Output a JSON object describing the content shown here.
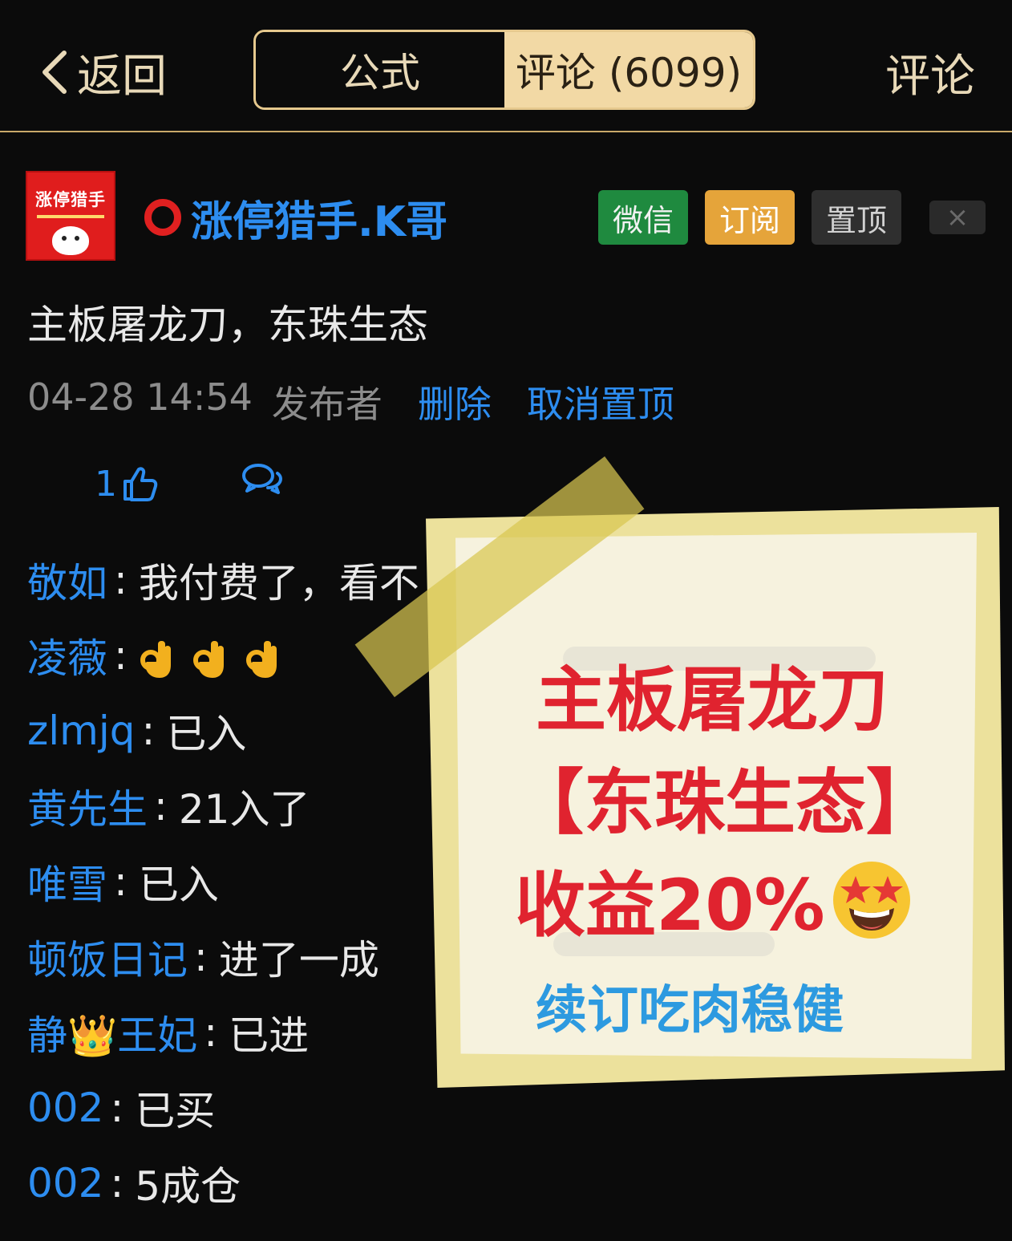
{
  "header": {
    "back_label": "返回",
    "tabs": [
      {
        "label": "公式",
        "active": false
      },
      {
        "label": "评论 (6099)",
        "active": true
      }
    ],
    "right_action": "评论"
  },
  "post": {
    "avatar_text": "涨停猎手",
    "author": "涨停猎手.K哥",
    "badges": {
      "wechat": "微信",
      "subscribe": "订阅",
      "pin": "置顶"
    },
    "close": "×",
    "content": "主板屠龙刀，东珠生态",
    "time": "04-28 14:54",
    "role": "发布者",
    "delete_label": "删除",
    "unpin_label": "取消置顶",
    "like_count": "1"
  },
  "comments": [
    {
      "name": "敬如",
      "text": "我付费了，看不"
    },
    {
      "name": "凌薇",
      "text": ""
    },
    {
      "name": "zlmjq",
      "text": "已入"
    },
    {
      "name": "黄先生",
      "text": "21入了"
    },
    {
      "name": "唯雪",
      "text": "已入"
    },
    {
      "name": "顿饭日记",
      "text": "进了一成"
    },
    {
      "name": "静👑王妃",
      "text": "已进"
    },
    {
      "name": "002",
      "text": "已买"
    },
    {
      "name": "002",
      "text": "5成仓"
    }
  ],
  "note": {
    "line1": "主板屠龙刀",
    "line2": "【东珠生态】",
    "line3": "收益20%",
    "line4": "续订吃肉稳健"
  },
  "colors": {
    "accent_gold": "#e6c98e",
    "link_blue": "#2d8df0",
    "note_red": "#e0232f",
    "wechat_green": "#1f8a3f",
    "subscribe_orange": "#e5a43a"
  }
}
